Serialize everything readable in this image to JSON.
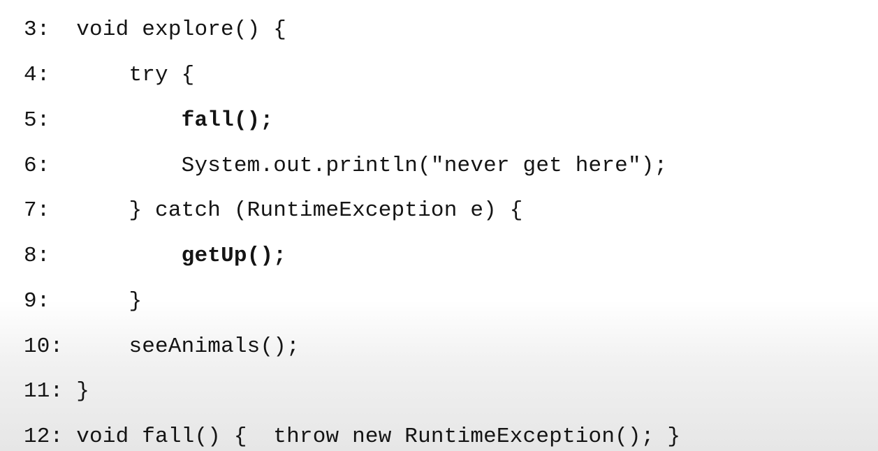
{
  "code": {
    "lines": [
      {
        "number": "3:",
        "indent": "",
        "text": "void explore() {",
        "bold": false
      },
      {
        "number": "4:",
        "indent": "    ",
        "text": "try {",
        "bold": false
      },
      {
        "number": "5:",
        "indent": "        ",
        "text": "fall();",
        "bold": true
      },
      {
        "number": "6:",
        "indent": "        ",
        "text": "System.out.println(\"never get here\");",
        "bold": false
      },
      {
        "number": "7:",
        "indent": "    ",
        "text": "} catch (RuntimeException e) {",
        "bold": false
      },
      {
        "number": "8:",
        "indent": "        ",
        "text": "getUp();",
        "bold": true
      },
      {
        "number": "9:",
        "indent": "    ",
        "text": "}",
        "bold": false
      },
      {
        "number": "10:",
        "indent": "   ",
        "text": "seeAnimals();",
        "bold": false
      },
      {
        "number": "11:",
        "indent": "",
        "text": "}",
        "bold": false
      },
      {
        "number": "12:",
        "indent": "",
        "text": "void fall() {  throw new RuntimeException(); }",
        "bold": false
      }
    ]
  }
}
